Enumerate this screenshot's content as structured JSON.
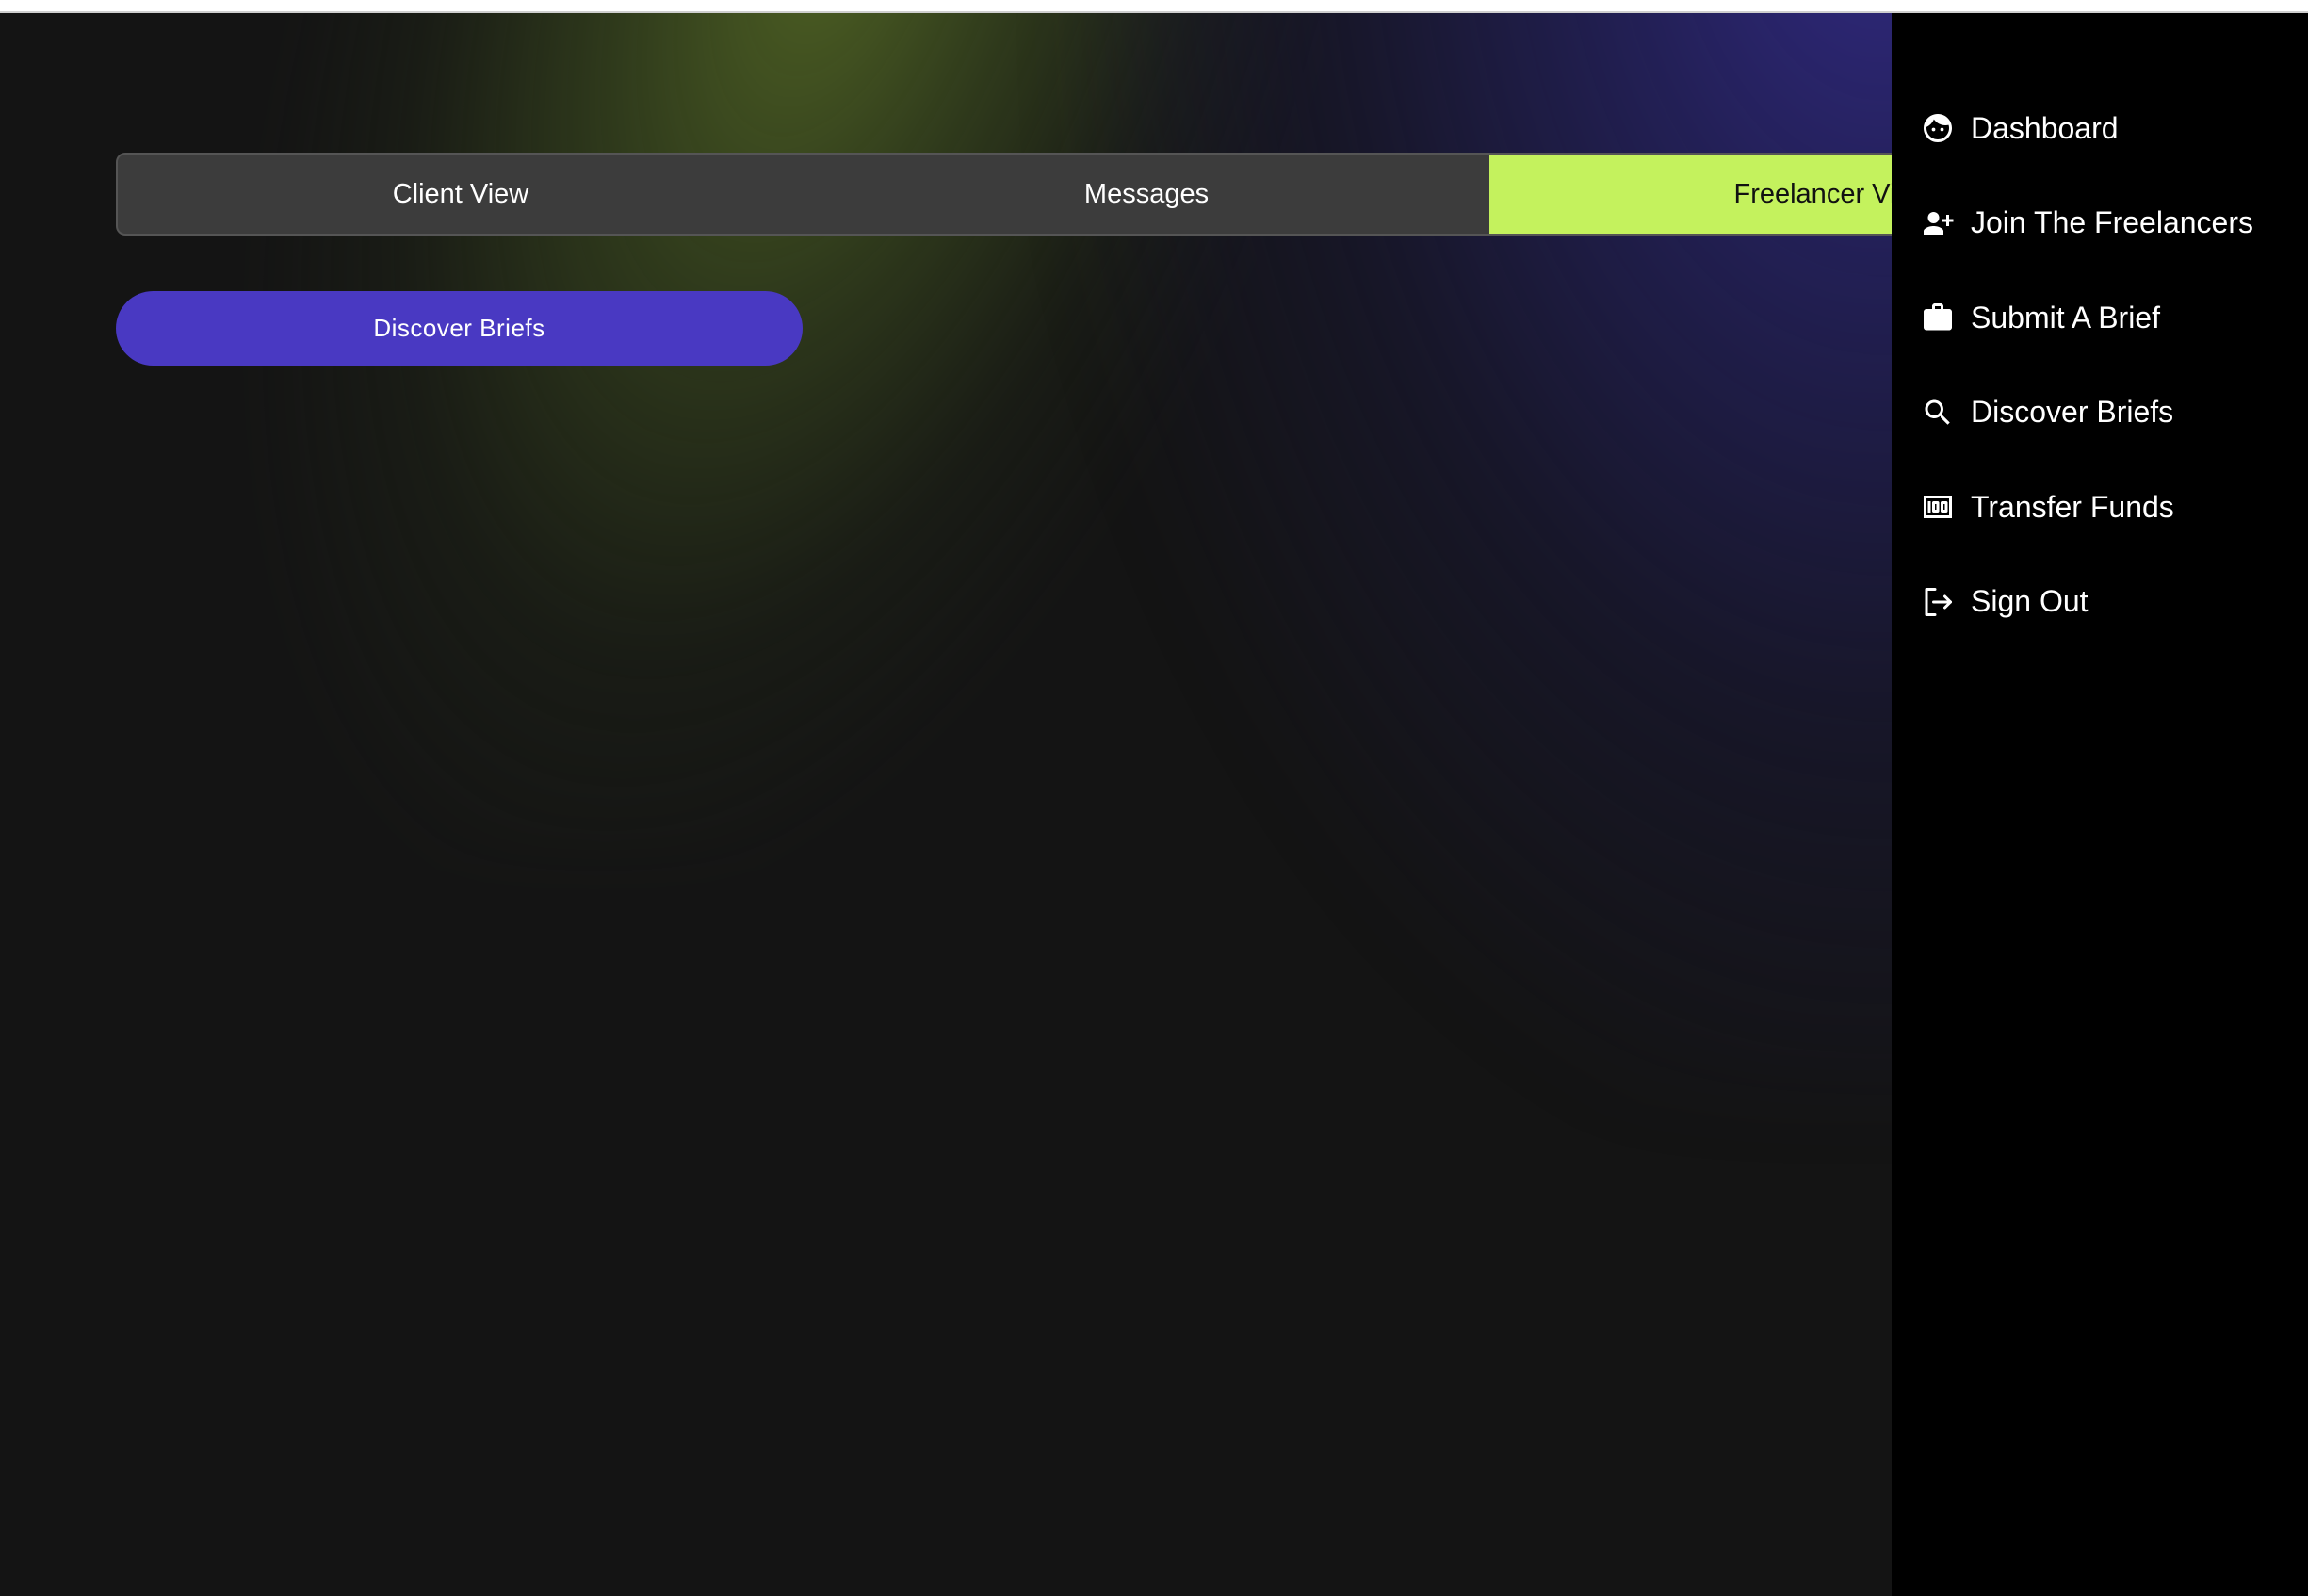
{
  "tabs": [
    {
      "label": "Client View",
      "active": false
    },
    {
      "label": "Messages",
      "active": false
    },
    {
      "label": "Freelancer View",
      "active": true
    }
  ],
  "discover_button": {
    "label": "Discover Briefs"
  },
  "side_menu": {
    "items": [
      {
        "label": "Dashboard",
        "icon": "face-icon"
      },
      {
        "label": "Join The Freelancers",
        "icon": "person-add-icon"
      },
      {
        "label": "Submit A Brief",
        "icon": "briefcase-icon"
      },
      {
        "label": "Discover Briefs",
        "icon": "search-icon"
      },
      {
        "label": "Transfer Funds",
        "icon": "money-icon"
      },
      {
        "label": "Sign Out",
        "icon": "sign-out-icon"
      }
    ]
  },
  "colors": {
    "background": "#141414",
    "tab_active": "#c4f25d",
    "button": "#4939c2",
    "side_menu": "#000000"
  }
}
